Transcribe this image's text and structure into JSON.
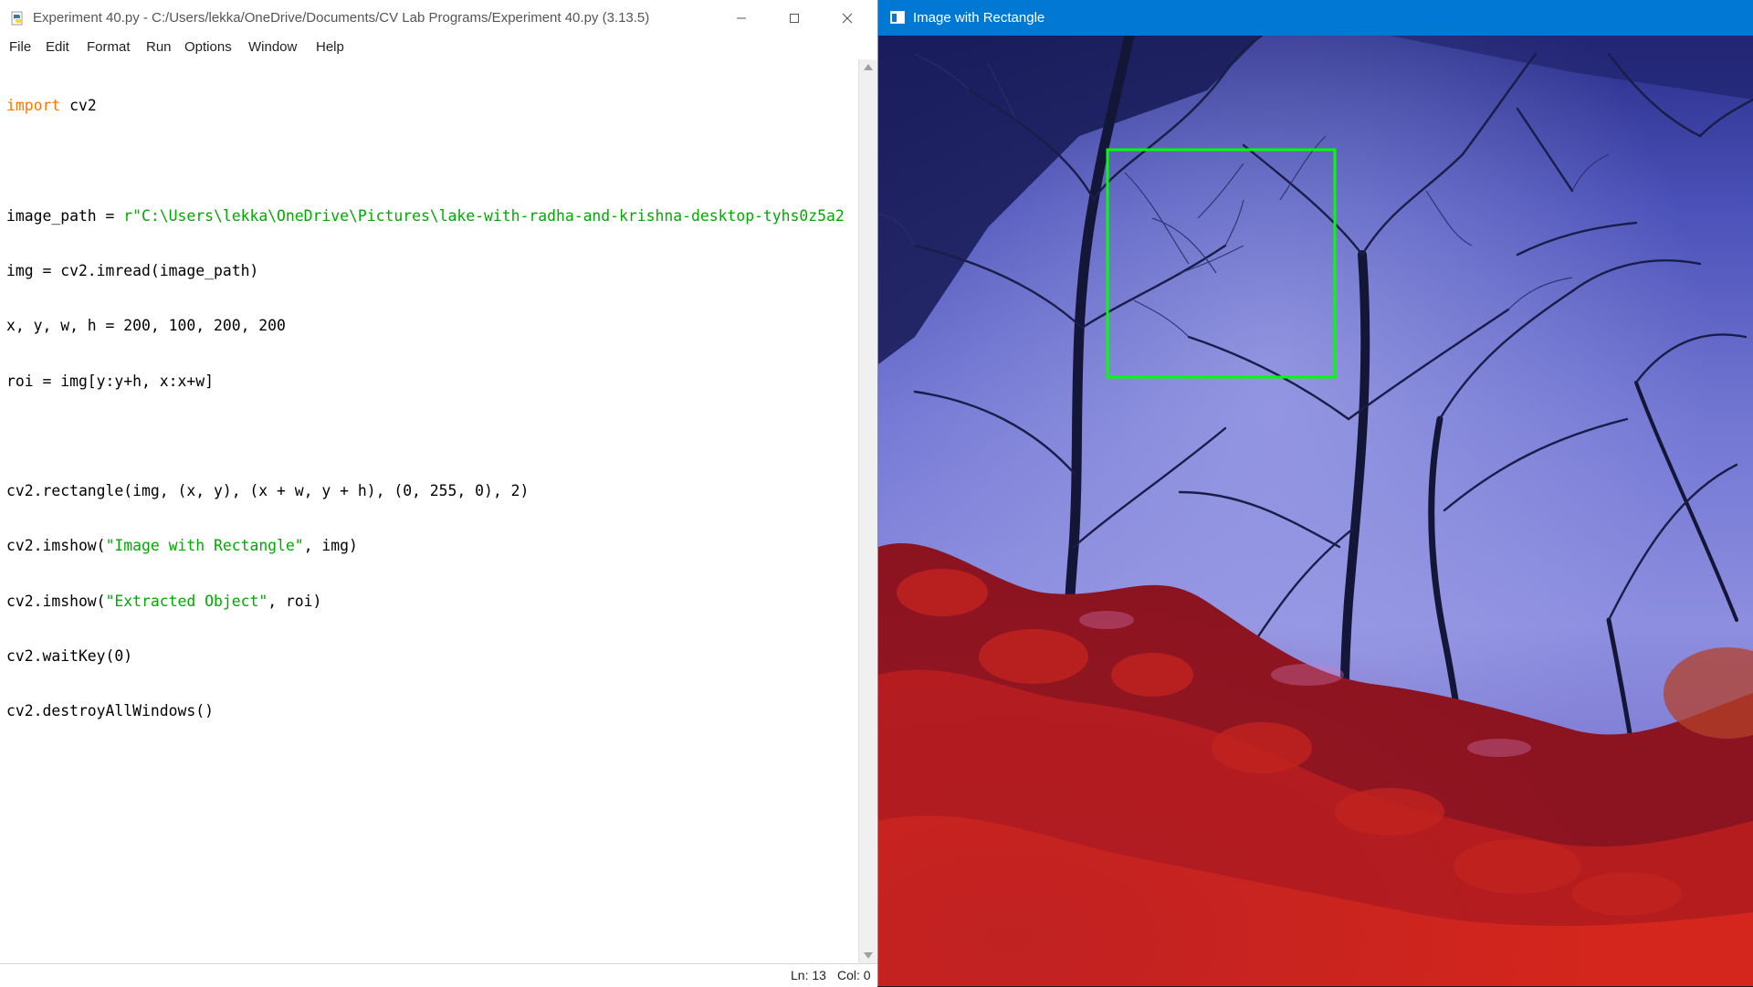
{
  "idle": {
    "window_title": "Experiment 40.py - C:/Users/lekka/OneDrive/Documents/CV Lab Programs/Experiment 40.py (3.13.5)",
    "window_controls": {
      "minimize": "minimize-icon",
      "maximize": "maximize-icon",
      "close": "close-icon"
    },
    "menu": [
      "File",
      "Edit",
      "Format",
      "Run",
      "Options",
      "Window",
      "Help"
    ],
    "code": {
      "l1_kw": "import",
      "l1_rest": " cv2",
      "l3_pre": "image_path = ",
      "l3_str": "r\"C:\\Users\\lekka\\OneDrive\\Pictures\\lake-with-radha-and-krishna-desktop-tyhs0z5a2",
      "l4": "img = cv2.imread(image_path)",
      "l5": "x, y, w, h = 200, 100, 200, 200",
      "l6": "roi = img[y:y+h, x:x+w]",
      "l8": "cv2.rectangle(img, (x, y), (x + w, y + h), (0, 255, 0), 2)",
      "l9_pre": "cv2.imshow(",
      "l9_str": "\"Image with Rectangle\"",
      "l9_post": ", img)",
      "l10_pre": "cv2.imshow(",
      "l10_str": "\"Extracted Object\"",
      "l10_post": ", roi)",
      "l11": "cv2.waitKey(0)",
      "l12": "cv2.destroyAllWindows()"
    },
    "status": {
      "line": "Ln: 13",
      "col": "Col: 0"
    },
    "colors": {
      "keyword": "#ff7700",
      "string": "#00aa00"
    }
  },
  "image_window": {
    "title": "Image with Rectangle",
    "titlebar_color": "#0078d4",
    "rectangle_color": "#00ff00"
  }
}
